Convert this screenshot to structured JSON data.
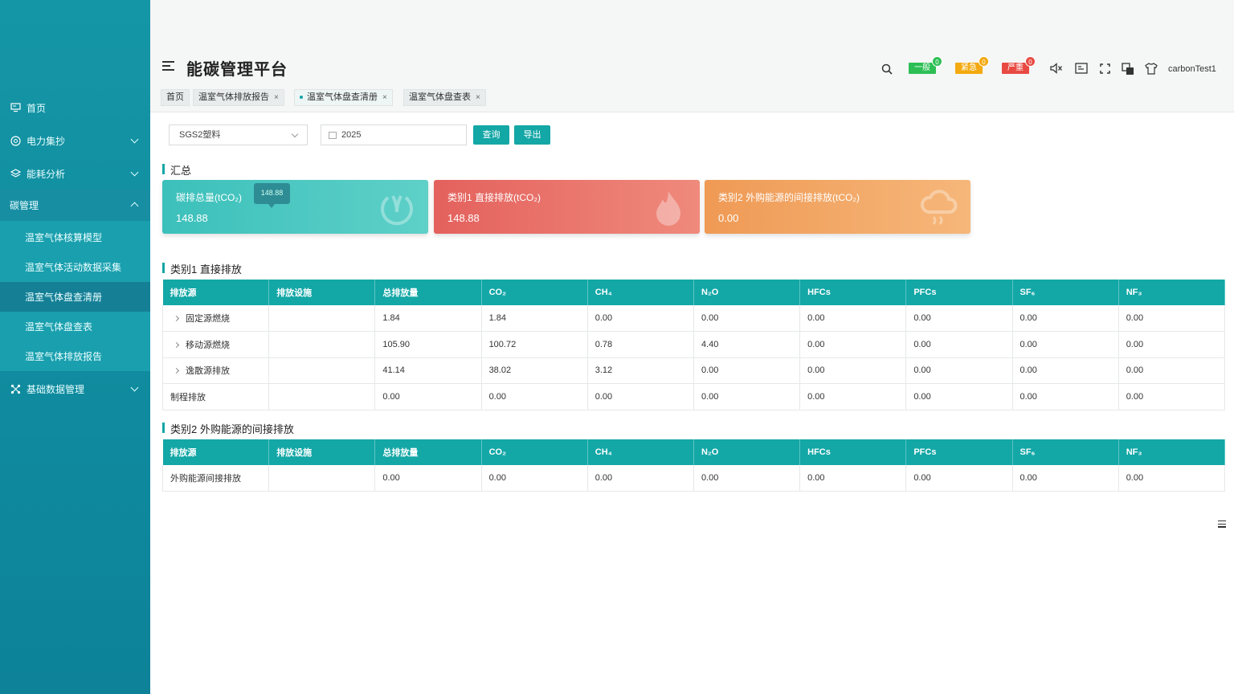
{
  "app": {
    "title": "能碳管理平台",
    "user": "carbonTest1"
  },
  "sidebar": {
    "items": [
      {
        "label": "首页",
        "icon": "monitor-icon"
      },
      {
        "label": "电力集抄",
        "icon": "meter-icon"
      },
      {
        "label": "能耗分析",
        "icon": "layers-icon"
      },
      {
        "label": "碳管理",
        "icon": "carbon-icon"
      },
      {
        "label": "基础数据管理",
        "icon": "nodes-icon"
      }
    ],
    "sub_items": [
      {
        "label": "温室气体核算模型"
      },
      {
        "label": "温室气体活动数据采集"
      },
      {
        "label": "温室气体盘查清册"
      },
      {
        "label": "温室气体盘查表"
      },
      {
        "label": "温室气体排放报告"
      }
    ]
  },
  "header": {
    "badges": [
      {
        "label": "一般",
        "count": "0",
        "color": "#2dbf55"
      },
      {
        "label": "紧急",
        "count": "0",
        "color": "#f3a90f"
      },
      {
        "label": "严重",
        "count": "0",
        "color": "#e84a43"
      }
    ]
  },
  "tabs": [
    {
      "label": "首页"
    },
    {
      "label": "温室气体排放报告"
    },
    {
      "label": "温室气体盘查清册"
    },
    {
      "label": "温室气体盘查表"
    }
  ],
  "filters": {
    "org_value": "SGS2塑料",
    "year_value": "2025",
    "query_label": "查询",
    "export_label": "导出"
  },
  "summary": {
    "title": "汇总",
    "tooltip": "148.88",
    "cards": [
      {
        "label": "碳排总量(tCO₂)",
        "value": "148.88",
        "color": "#3cc0bb"
      },
      {
        "label": "类别1 直接排放(tCO₂)",
        "value": "148.88",
        "color": "#e96a65"
      },
      {
        "label": "类别2 外购能源的间接排放(tCO₂)",
        "value": "0.00",
        "color": "#f29f5a"
      }
    ]
  },
  "columns": [
    "排放源",
    "排放设施",
    "总排放量",
    "CO₂",
    "CH₄",
    "N₂O",
    "HFCs",
    "PFCs",
    "SF₆",
    "NF₃"
  ],
  "category1": {
    "title": "类别1 直接排放",
    "rows": [
      {
        "expandable": true,
        "cells": [
          "固定源燃烧",
          "",
          "1.84",
          "1.84",
          "0.00",
          "0.00",
          "0.00",
          "0.00",
          "0.00",
          "0.00"
        ]
      },
      {
        "expandable": true,
        "cells": [
          "移动源燃烧",
          "",
          "105.90",
          "100.72",
          "0.78",
          "4.40",
          "0.00",
          "0.00",
          "0.00",
          "0.00"
        ]
      },
      {
        "expandable": true,
        "cells": [
          "逸散源排放",
          "",
          "41.14",
          "38.02",
          "3.12",
          "0.00",
          "0.00",
          "0.00",
          "0.00",
          "0.00"
        ]
      },
      {
        "expandable": false,
        "cells": [
          "制程排放",
          "",
          "0.00",
          "0.00",
          "0.00",
          "0.00",
          "0.00",
          "0.00",
          "0.00",
          "0.00"
        ]
      }
    ]
  },
  "category2": {
    "title": "类别2 外购能源的间接排放",
    "rows": [
      {
        "expandable": false,
        "cells": [
          "外购能源间接排放",
          "",
          "0.00",
          "0.00",
          "0.00",
          "0.00",
          "0.00",
          "0.00",
          "0.00",
          "0.00"
        ]
      }
    ]
  }
}
